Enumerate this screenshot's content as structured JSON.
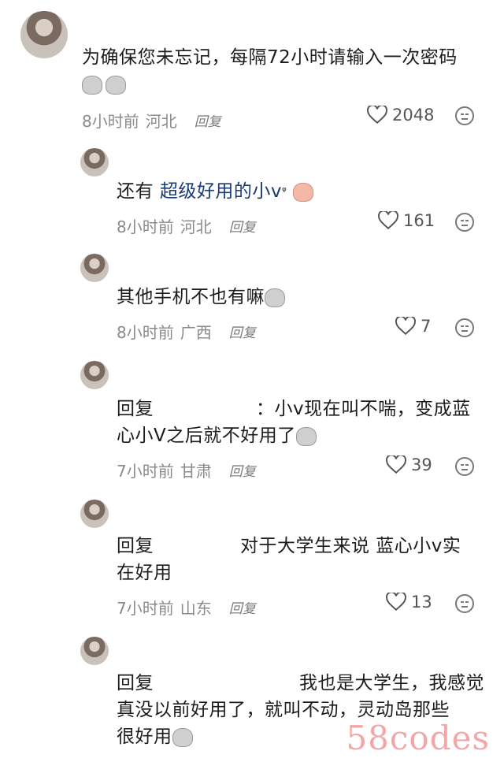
{
  "comments": [
    {
      "text": "为确保您未忘记，每隔72小时请输入一次密码",
      "time": "8小时前",
      "location": "河北",
      "reply_label": "回复",
      "likes": "2048"
    },
    {
      "text_prefix": "还有",
      "text_highlight": "超级好用的小v",
      "time": "8小时前",
      "location": "河北",
      "reply_label": "回复",
      "likes": "161"
    },
    {
      "text": "其他手机不也有嘛",
      "time": "8小时前",
      "location": "广西",
      "reply_label": "回复",
      "likes": "7"
    },
    {
      "reply_prefix": "回复",
      "text_line1": "：小v现在叫不喘，变成蓝",
      "text_line2": "心小V之后就不好用了",
      "time": "7小时前",
      "location": "甘肃",
      "reply_label": "回复",
      "likes": "39"
    },
    {
      "reply_prefix": "回复",
      "text_line1": "对于大学生来说 蓝心小v实",
      "text_line2": "在好用",
      "time": "7小时前",
      "location": "山东",
      "reply_label": "回复",
      "likes": "13"
    },
    {
      "reply_prefix": "回复",
      "text_line1": "我也是大学生，我感觉",
      "text_line2": "真没以前好用了，就叫不动，灵动岛那些",
      "text_line3": "很好用"
    }
  ],
  "watermark": "58codes"
}
